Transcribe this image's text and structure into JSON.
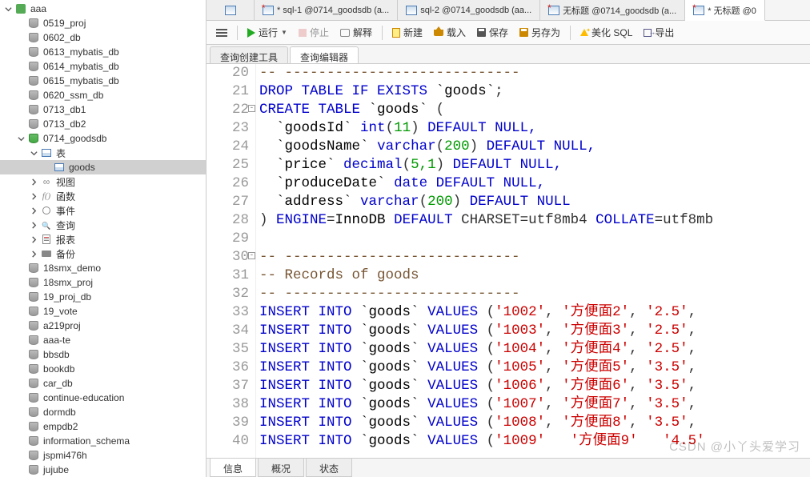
{
  "sidebar": {
    "root": "aaa",
    "nodes": [
      {
        "label": "0519_proj",
        "icon": "db-gray",
        "indent": 1
      },
      {
        "label": "0602_db",
        "icon": "db-gray",
        "indent": 1
      },
      {
        "label": "0613_mybatis_db",
        "icon": "db-gray",
        "indent": 1
      },
      {
        "label": "0614_mybatis_db",
        "icon": "db-gray",
        "indent": 1
      },
      {
        "label": "0615_mybatis_db",
        "icon": "db-gray",
        "indent": 1
      },
      {
        "label": "0620_ssm_db",
        "icon": "db-gray",
        "indent": 1
      },
      {
        "label": "0713_db1",
        "icon": "db-gray",
        "indent": 1
      },
      {
        "label": "0713_db2",
        "icon": "db-gray",
        "indent": 1
      },
      {
        "label": "0714_goodsdb",
        "icon": "db",
        "indent": 1,
        "expander": "open"
      },
      {
        "label": "表",
        "icon": "table",
        "indent": 2,
        "expander": "open"
      },
      {
        "label": "goods",
        "icon": "table",
        "indent": 3,
        "selected": true
      },
      {
        "label": "视图",
        "icon": "view",
        "indent": 2,
        "expander": "closed"
      },
      {
        "label": "函数",
        "icon": "fn",
        "indent": 2,
        "expander": "closed"
      },
      {
        "label": "事件",
        "icon": "event",
        "indent": 2,
        "expander": "closed"
      },
      {
        "label": "查询",
        "icon": "query",
        "indent": 2,
        "expander": "closed"
      },
      {
        "label": "报表",
        "icon": "report",
        "indent": 2,
        "expander": "closed"
      },
      {
        "label": "备份",
        "icon": "backup",
        "indent": 2,
        "expander": "closed"
      },
      {
        "label": "18smx_demo",
        "icon": "db-gray",
        "indent": 1
      },
      {
        "label": "18smx_proj",
        "icon": "db-gray",
        "indent": 1
      },
      {
        "label": "19_proj_db",
        "icon": "db-gray",
        "indent": 1
      },
      {
        "label": "19_vote",
        "icon": "db-gray",
        "indent": 1
      },
      {
        "label": "a219proj",
        "icon": "db-gray",
        "indent": 1
      },
      {
        "label": "aaa-te",
        "icon": "db-gray",
        "indent": 1
      },
      {
        "label": "bbsdb",
        "icon": "db-gray",
        "indent": 1
      },
      {
        "label": "bookdb",
        "icon": "db-gray",
        "indent": 1
      },
      {
        "label": "car_db",
        "icon": "db-gray",
        "indent": 1
      },
      {
        "label": "continue-education",
        "icon": "db-gray",
        "indent": 1
      },
      {
        "label": "dormdb",
        "icon": "db-gray",
        "indent": 1
      },
      {
        "label": "empdb2",
        "icon": "db-gray",
        "indent": 1
      },
      {
        "label": "information_schema",
        "icon": "db-gray",
        "indent": 1
      },
      {
        "label": "jspmi476h",
        "icon": "db-gray",
        "indent": 1
      },
      {
        "label": "jujube",
        "icon": "db-gray",
        "indent": 1
      }
    ]
  },
  "topTabs": [
    {
      "label": "",
      "icon": "home"
    },
    {
      "label": "* sql-1 @0714_goodsdb (a...",
      "star": true
    },
    {
      "label": "sql-2 @0714_goodsdb (aa...",
      "star": false
    },
    {
      "label": "无标题 @0714_goodsdb (a...",
      "star": true
    },
    {
      "label": "* 无标题 @0",
      "star": true,
      "active": true
    }
  ],
  "toolbar": {
    "run": "运行",
    "stop": "停止",
    "explain": "解释",
    "new": "新建",
    "load": "载入",
    "save": "保存",
    "saveas": "另存为",
    "pretty": "美化 SQL",
    "export": "导出"
  },
  "subTabs": [
    "查询创建工具",
    "查询编辑器"
  ],
  "subTabActive": 1,
  "code": {
    "startLine": 20,
    "lines": [
      {
        "n": 20,
        "t": "cmt",
        "raw": "-- ----------------------------"
      },
      {
        "n": 21,
        "t": "sql1"
      },
      {
        "n": 22,
        "t": "sql2",
        "fold": "-"
      },
      {
        "n": 23,
        "t": "col",
        "name": "goodsId",
        "ty": "int",
        "arg": "11",
        "tail": " DEFAULT NULL,"
      },
      {
        "n": 24,
        "t": "col",
        "name": "goodsName",
        "ty": "varchar",
        "arg": "200",
        "tail": " DEFAULT NULL,"
      },
      {
        "n": 25,
        "t": "col",
        "name": "price",
        "ty": "decimal",
        "arg": "5,1",
        "tail": " DEFAULT NULL,"
      },
      {
        "n": 26,
        "t": "col2",
        "name": "produceDate",
        "ty": "date",
        "tail": " DEFAULT NULL,"
      },
      {
        "n": 27,
        "t": "col",
        "name": "address",
        "ty": "varchar",
        "arg": "200",
        "tail": " DEFAULT NULL"
      },
      {
        "n": 28,
        "t": "eng"
      },
      {
        "n": 29,
        "t": "blank"
      },
      {
        "n": 30,
        "t": "cmt",
        "raw": "-- ----------------------------",
        "fold": "-"
      },
      {
        "n": 31,
        "t": "cmt",
        "raw": "-- Records of goods"
      },
      {
        "n": 32,
        "t": "cmt",
        "raw": "-- ----------------------------"
      },
      {
        "n": 33,
        "t": "ins",
        "v1": "1002",
        "v2": "方便面2",
        "v3": "2.5"
      },
      {
        "n": 34,
        "t": "ins",
        "v1": "1003",
        "v2": "方便面3",
        "v3": "2.5"
      },
      {
        "n": 35,
        "t": "ins",
        "v1": "1004",
        "v2": "方便面4",
        "v3": "2.5"
      },
      {
        "n": 36,
        "t": "ins",
        "v1": "1005",
        "v2": "方便面5",
        "v3": "3.5"
      },
      {
        "n": 37,
        "t": "ins",
        "v1": "1006",
        "v2": "方便面6",
        "v3": "3.5"
      },
      {
        "n": 38,
        "t": "ins",
        "v1": "1007",
        "v2": "方便面7",
        "v3": "3.5"
      },
      {
        "n": 39,
        "t": "ins",
        "v1": "1008",
        "v2": "方便面8",
        "v3": "3.5"
      },
      {
        "n": 40,
        "t": "ins",
        "v1": "1009",
        "v2": "方便面9",
        "v3": "4.5",
        "partial": true
      }
    ]
  },
  "bottomTabs": [
    "信息",
    "概况",
    "状态"
  ],
  "bottomTabActive": 0,
  "watermark": "CSDN @小丫头爱学习"
}
